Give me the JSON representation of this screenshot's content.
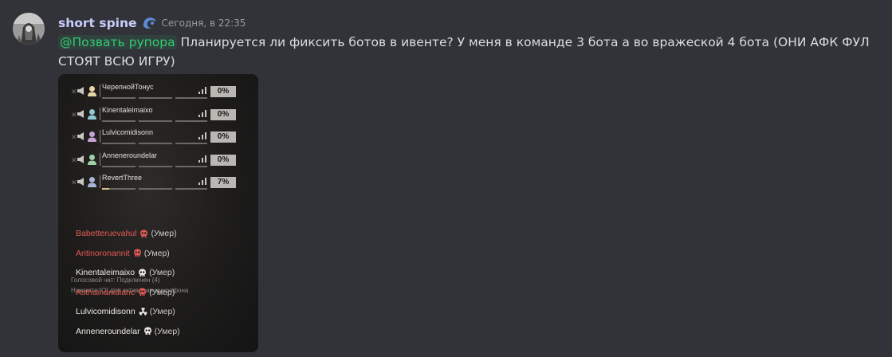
{
  "author": {
    "username": "short spine",
    "badge_icon": "crescent-badge-icon",
    "timestamp": "Сегодня, в 22:35"
  },
  "message": {
    "mention": "@Позвать рупора",
    "text": " Планируется ли фиксить ботов в ивенте? У меня в команде 3 бота а во вражеской 4 бота (ОНИ АФК ФУЛ СТОЯТ ВСЮ ИГРУ)"
  },
  "attachment": {
    "players": [
      {
        "name": "ЧерепнойТонус",
        "percent": "0%",
        "fill": 0,
        "person_color": "#e8d6a2"
      },
      {
        "name": "Kinentaleimaixo",
        "percent": "0%",
        "fill": 0,
        "person_color": "#8fc9d4"
      },
      {
        "name": "Lulvicomidisonn",
        "percent": "0%",
        "fill": 0,
        "person_color": "#c4a3d6"
      },
      {
        "name": "Anneneroundelar",
        "percent": "0%",
        "fill": 0,
        "person_color": "#9fd0a8"
      },
      {
        "name": "RevertThree",
        "percent": "7%",
        "fill": 0.07,
        "person_color": "#a9b4d8"
      }
    ],
    "voice_status": "Голосовой чат: Подключен (4)",
    "voice_hint": "Нажмите [O] для активации микрофона",
    "killfeed": [
      {
        "name": "Babetteruevahul",
        "status": "(Умер)",
        "enemy": true,
        "icon": "skull-icon"
      },
      {
        "name": "Aritinoronannit",
        "status": "(Умер)",
        "enemy": true,
        "icon": "skull-icon"
      },
      {
        "name": "Kinentaleimaixo",
        "status": "(Умер)",
        "enemy": false,
        "icon": "skull-icon"
      },
      {
        "name": "Asthainanidianc",
        "status": "(Умер)",
        "enemy": true,
        "icon": "skull-icon"
      },
      {
        "name": "Lulvicomidisonn",
        "status": "(Умер)",
        "enemy": false,
        "icon": "radiation-icon"
      },
      {
        "name": "Anneneroundelar",
        "status": "(Умер)",
        "enemy": false,
        "icon": "skull-icon"
      }
    ]
  },
  "colors": {
    "background": "#313338",
    "username": "#c9cdfb",
    "role_mention": "#2ecc71",
    "enemy": "#e35a55",
    "ally": "#eceae6"
  }
}
